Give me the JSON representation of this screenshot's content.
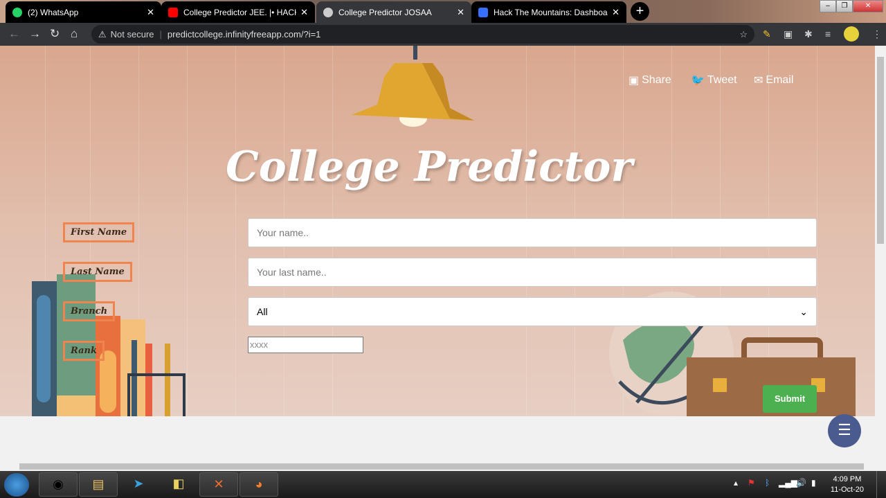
{
  "browser": {
    "tabs": [
      {
        "title": "(2) WhatsApp",
        "icon": "whatsapp-icon",
        "color": "#25d366"
      },
      {
        "title": "College Predictor JEE. |• HACK",
        "icon": "youtube-icon",
        "color": "#ff0000"
      },
      {
        "title": "College Predictor JOSAA",
        "icon": "globe-icon",
        "color": "#ccc",
        "active": true
      },
      {
        "title": "Hack The Mountains: Dashboard",
        "icon": "devfolio-icon",
        "color": "#3770ff"
      }
    ],
    "security": "Not secure",
    "url": "predictcollege.infinityfreeapp.com/?i=1"
  },
  "page": {
    "share": [
      {
        "label": "Share",
        "icon": "facebook-icon"
      },
      {
        "label": "Tweet",
        "icon": "twitter-icon"
      },
      {
        "label": "Email",
        "icon": "email-icon"
      }
    ],
    "title": "College Predictor",
    "labels": {
      "first": "First Name",
      "last": "Last Name",
      "branch": "Branch",
      "rank": "Rank"
    },
    "fields": {
      "first_placeholder": "Your name..",
      "last_placeholder": "Your last name..",
      "branch_value": "All",
      "rank_placeholder": "xxxx"
    },
    "submit": "Submit"
  },
  "taskbar": {
    "time": "4:09 PM",
    "date": "11-Oct-20"
  },
  "colors": {
    "accent": "#f0844e",
    "submit": "#4caf50",
    "chat": "#4a5b8f"
  }
}
